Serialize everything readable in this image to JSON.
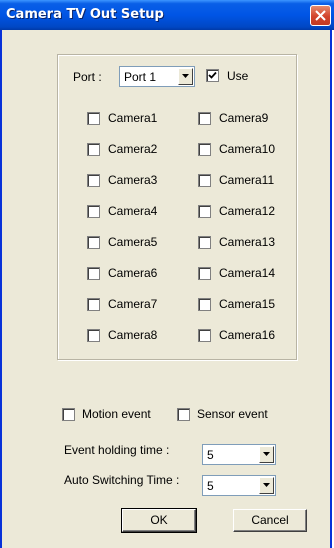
{
  "window": {
    "title": "Camera TV Out Setup"
  },
  "port": {
    "label": "Port :",
    "value": "Port 1",
    "use_label": "Use",
    "use_checked": true
  },
  "cameras": [
    "Camera1",
    "Camera2",
    "Camera3",
    "Camera4",
    "Camera5",
    "Camera6",
    "Camera7",
    "Camera8",
    "Camera9",
    "Camera10",
    "Camera11",
    "Camera12",
    "Camera13",
    "Camera14",
    "Camera15",
    "Camera16"
  ],
  "events": {
    "motion_label": "Motion event",
    "sensor_label": "Sensor event"
  },
  "event_holding": {
    "label": "Event holding time :",
    "value": "5"
  },
  "auto_switching": {
    "label": "Auto Switching Time :",
    "value": "5"
  },
  "buttons": {
    "ok": "OK",
    "cancel": "Cancel"
  }
}
